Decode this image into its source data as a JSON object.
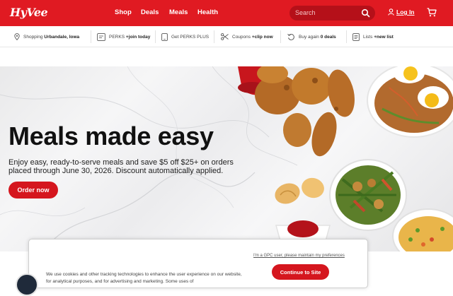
{
  "header": {
    "logo": "HyVee",
    "nav": [
      "Shop",
      "Deals",
      "Meals",
      "Health"
    ],
    "search_placeholder": "Search",
    "login_label": "Log In",
    "colors": {
      "brand": "#e01a22"
    }
  },
  "subbar": {
    "store_prefix": "Shopping",
    "store_name": "Urbandale, Iowa",
    "perks": "PERKS",
    "perks_action": "+join today",
    "perks_plus": "Get PERKS PLUS",
    "coupons": "Coupons",
    "coupons_action": "+clip now",
    "buy_again": "Buy again",
    "buy_again_count": "0 deals",
    "lists": "Lists",
    "lists_action": "+new list"
  },
  "hero": {
    "title": "Meals made easy",
    "text": "Enjoy easy, ready-to-serve meals and save $5 off $25+ on orders placed through June 30, 2026. Discount automatically applied.",
    "button": "Order now"
  },
  "cookie": {
    "gpc_link": "I'm a GPC user, please maintain my preferences",
    "button": "Continue to Site",
    "text": "We use cookies and other tracking technologies to enhance the user experience on our website, for analytical purposes, and for advertising and marketing. Some uses of"
  }
}
